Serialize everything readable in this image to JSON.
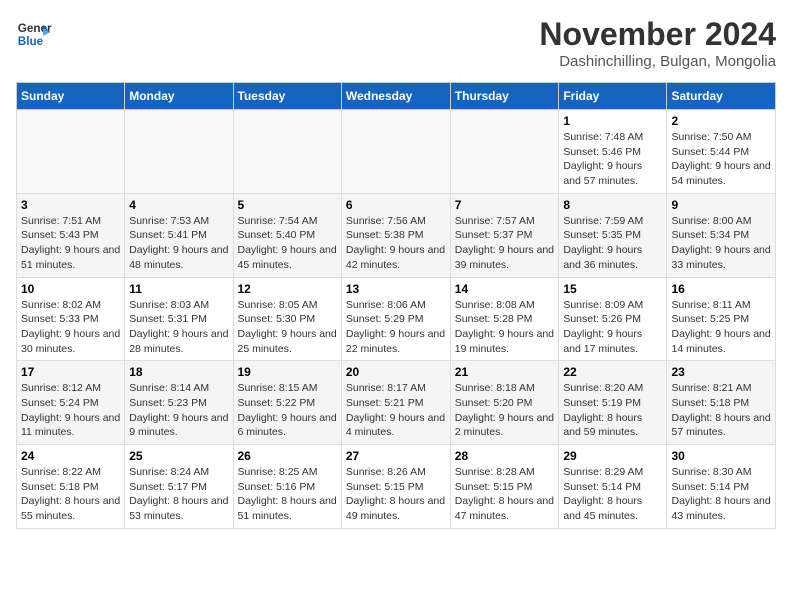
{
  "logo": {
    "line1": "General",
    "line2": "Blue"
  },
  "title": "November 2024",
  "subtitle": "Dashinchilling, Bulgan, Mongolia",
  "headers": [
    "Sunday",
    "Monday",
    "Tuesday",
    "Wednesday",
    "Thursday",
    "Friday",
    "Saturday"
  ],
  "weeks": [
    [
      {
        "day": "",
        "info": ""
      },
      {
        "day": "",
        "info": ""
      },
      {
        "day": "",
        "info": ""
      },
      {
        "day": "",
        "info": ""
      },
      {
        "day": "",
        "info": ""
      },
      {
        "day": "1",
        "info": "Sunrise: 7:48 AM\nSunset: 5:46 PM\nDaylight: 9 hours and 57 minutes."
      },
      {
        "day": "2",
        "info": "Sunrise: 7:50 AM\nSunset: 5:44 PM\nDaylight: 9 hours and 54 minutes."
      }
    ],
    [
      {
        "day": "3",
        "info": "Sunrise: 7:51 AM\nSunset: 5:43 PM\nDaylight: 9 hours and 51 minutes."
      },
      {
        "day": "4",
        "info": "Sunrise: 7:53 AM\nSunset: 5:41 PM\nDaylight: 9 hours and 48 minutes."
      },
      {
        "day": "5",
        "info": "Sunrise: 7:54 AM\nSunset: 5:40 PM\nDaylight: 9 hours and 45 minutes."
      },
      {
        "day": "6",
        "info": "Sunrise: 7:56 AM\nSunset: 5:38 PM\nDaylight: 9 hours and 42 minutes."
      },
      {
        "day": "7",
        "info": "Sunrise: 7:57 AM\nSunset: 5:37 PM\nDaylight: 9 hours and 39 minutes."
      },
      {
        "day": "8",
        "info": "Sunrise: 7:59 AM\nSunset: 5:35 PM\nDaylight: 9 hours and 36 minutes."
      },
      {
        "day": "9",
        "info": "Sunrise: 8:00 AM\nSunset: 5:34 PM\nDaylight: 9 hours and 33 minutes."
      }
    ],
    [
      {
        "day": "10",
        "info": "Sunrise: 8:02 AM\nSunset: 5:33 PM\nDaylight: 9 hours and 30 minutes."
      },
      {
        "day": "11",
        "info": "Sunrise: 8:03 AM\nSunset: 5:31 PM\nDaylight: 9 hours and 28 minutes."
      },
      {
        "day": "12",
        "info": "Sunrise: 8:05 AM\nSunset: 5:30 PM\nDaylight: 9 hours and 25 minutes."
      },
      {
        "day": "13",
        "info": "Sunrise: 8:06 AM\nSunset: 5:29 PM\nDaylight: 9 hours and 22 minutes."
      },
      {
        "day": "14",
        "info": "Sunrise: 8:08 AM\nSunset: 5:28 PM\nDaylight: 9 hours and 19 minutes."
      },
      {
        "day": "15",
        "info": "Sunrise: 8:09 AM\nSunset: 5:26 PM\nDaylight: 9 hours and 17 minutes."
      },
      {
        "day": "16",
        "info": "Sunrise: 8:11 AM\nSunset: 5:25 PM\nDaylight: 9 hours and 14 minutes."
      }
    ],
    [
      {
        "day": "17",
        "info": "Sunrise: 8:12 AM\nSunset: 5:24 PM\nDaylight: 9 hours and 11 minutes."
      },
      {
        "day": "18",
        "info": "Sunrise: 8:14 AM\nSunset: 5:23 PM\nDaylight: 9 hours and 9 minutes."
      },
      {
        "day": "19",
        "info": "Sunrise: 8:15 AM\nSunset: 5:22 PM\nDaylight: 9 hours and 6 minutes."
      },
      {
        "day": "20",
        "info": "Sunrise: 8:17 AM\nSunset: 5:21 PM\nDaylight: 9 hours and 4 minutes."
      },
      {
        "day": "21",
        "info": "Sunrise: 8:18 AM\nSunset: 5:20 PM\nDaylight: 9 hours and 2 minutes."
      },
      {
        "day": "22",
        "info": "Sunrise: 8:20 AM\nSunset: 5:19 PM\nDaylight: 8 hours and 59 minutes."
      },
      {
        "day": "23",
        "info": "Sunrise: 8:21 AM\nSunset: 5:18 PM\nDaylight: 8 hours and 57 minutes."
      }
    ],
    [
      {
        "day": "24",
        "info": "Sunrise: 8:22 AM\nSunset: 5:18 PM\nDaylight: 8 hours and 55 minutes."
      },
      {
        "day": "25",
        "info": "Sunrise: 8:24 AM\nSunset: 5:17 PM\nDaylight: 8 hours and 53 minutes."
      },
      {
        "day": "26",
        "info": "Sunrise: 8:25 AM\nSunset: 5:16 PM\nDaylight: 8 hours and 51 minutes."
      },
      {
        "day": "27",
        "info": "Sunrise: 8:26 AM\nSunset: 5:15 PM\nDaylight: 8 hours and 49 minutes."
      },
      {
        "day": "28",
        "info": "Sunrise: 8:28 AM\nSunset: 5:15 PM\nDaylight: 8 hours and 47 minutes."
      },
      {
        "day": "29",
        "info": "Sunrise: 8:29 AM\nSunset: 5:14 PM\nDaylight: 8 hours and 45 minutes."
      },
      {
        "day": "30",
        "info": "Sunrise: 8:30 AM\nSunset: 5:14 PM\nDaylight: 8 hours and 43 minutes."
      }
    ]
  ]
}
